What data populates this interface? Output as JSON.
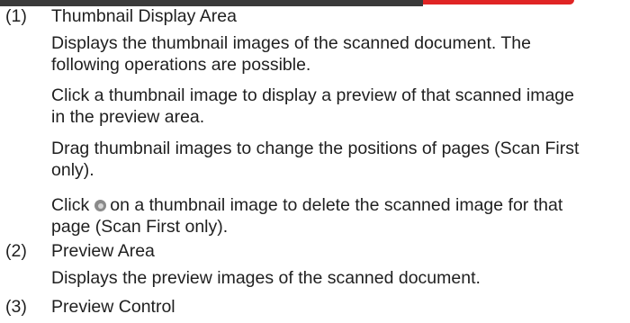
{
  "items": [
    {
      "number": "(1)",
      "heading": "Thumbnail Display Area",
      "desc_line1": "Displays the thumbnail images of the scanned document. The",
      "desc_line2": "following operations are possible.",
      "op1_line1": "Click a thumbnail image to display a preview of that scanned image",
      "op1_line2": "in the preview area.",
      "op2_line1": "Drag thumbnail images to change the positions of pages (Scan First",
      "op2_line2": "only).",
      "op3_before_icon": "Click",
      "op3_icon": "delete-circle-icon",
      "op3_after_icon": "on a thumbnail image to delete the scanned image for that",
      "op3_line2": "page (Scan First only)."
    },
    {
      "number": "(2)",
      "heading": "Preview Area",
      "desc": "Displays the preview images of the scanned document."
    },
    {
      "number": "(3)",
      "heading": "Preview Control"
    }
  ]
}
